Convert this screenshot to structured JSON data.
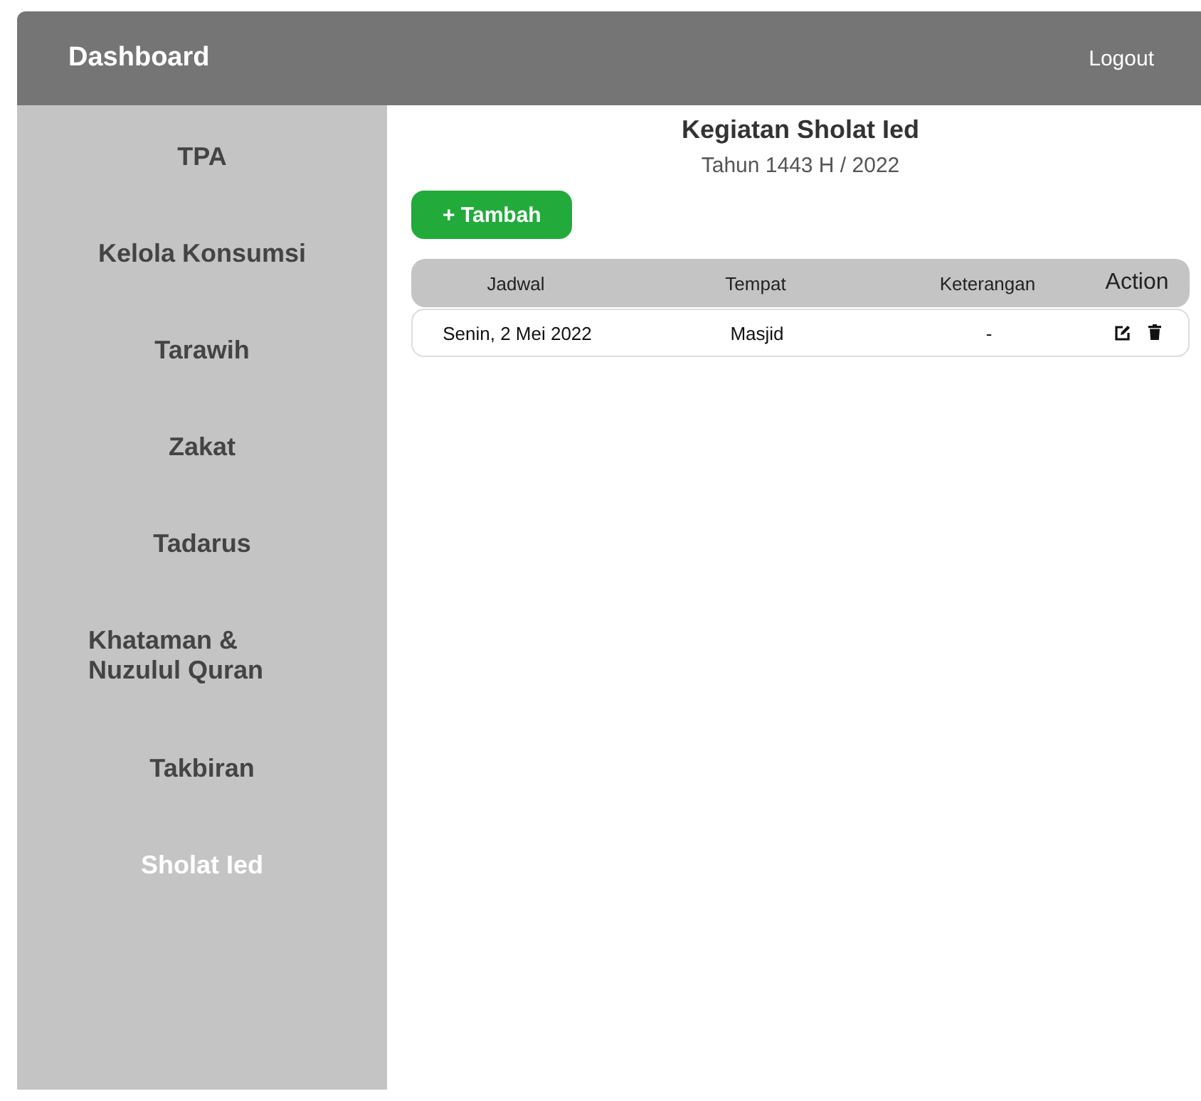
{
  "header": {
    "title": "Dashboard",
    "logout": "Logout"
  },
  "sidebar": {
    "items": [
      {
        "label": "TPA",
        "selected": false
      },
      {
        "label": "Kelola Konsumsi",
        "selected": false
      },
      {
        "label": "Tarawih",
        "selected": false
      },
      {
        "label": "Zakat",
        "selected": false
      },
      {
        "label": "Tadarus",
        "selected": false
      },
      {
        "label": "Khataman & Nuzulul Quran",
        "selected": false
      },
      {
        "label": "Takbiran",
        "selected": false
      },
      {
        "label": "Sholat Ied",
        "selected": true
      }
    ]
  },
  "main": {
    "title": "Kegiatan Sholat Ied",
    "subtitle": "Tahun 1443 H / 2022",
    "add_button": "+ Tambah",
    "table": {
      "columns": [
        "Jadwal",
        "Tempat",
        "Keterangan",
        "Action"
      ],
      "rows": [
        {
          "cells": [
            "Senin, 2 Mei 2022",
            "Masjid",
            "-"
          ]
        }
      ]
    }
  }
}
